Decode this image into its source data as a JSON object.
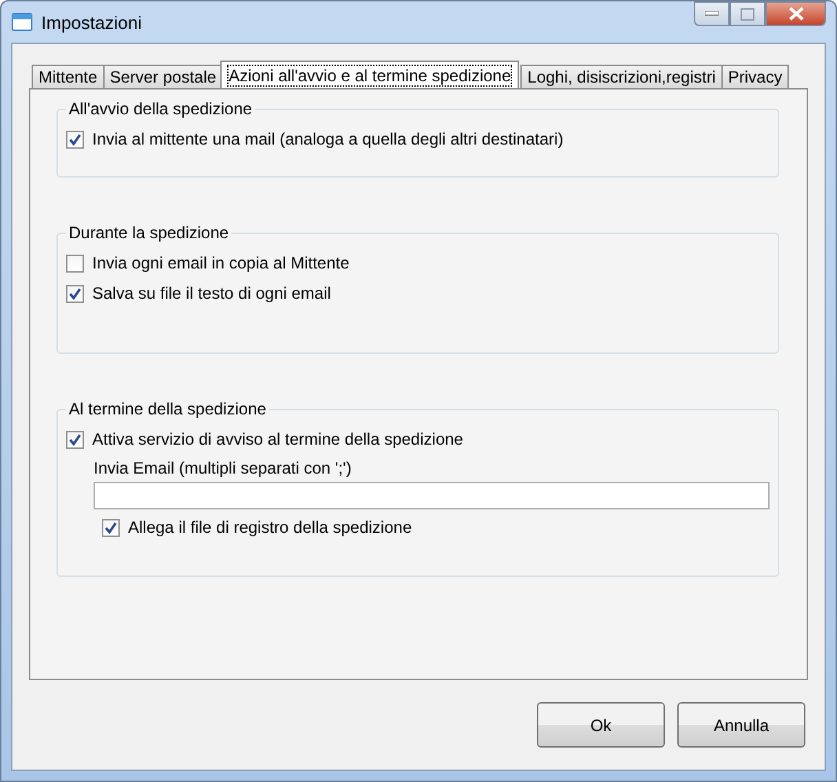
{
  "window": {
    "title": "Impostazioni"
  },
  "tabs": [
    {
      "label": "Mittente",
      "selected": false
    },
    {
      "label": "Server postale",
      "selected": false
    },
    {
      "label": "Azioni all'avvio e al termine spedizione",
      "selected": true
    },
    {
      "label": "Loghi, disiscrizioni,registri",
      "selected": false
    },
    {
      "label": "Privacy",
      "selected": false
    }
  ],
  "groups": [
    {
      "title": "All'avvio della spedizione",
      "items": [
        {
          "kind": "checkbox",
          "label": "Invia al mittente una mail (analoga a quella degli altri destinatari)",
          "checked": true
        }
      ]
    },
    {
      "title": "Durante la spedizione",
      "items": [
        {
          "kind": "checkbox",
          "label": "Invia ogni email in copia al Mittente",
          "checked": false
        },
        {
          "kind": "checkbox",
          "label": "Salva su file il testo di ogni email",
          "checked": true
        }
      ]
    },
    {
      "title": "Al termine della spedizione",
      "items": [
        {
          "kind": "checkbox",
          "label": "Attiva servizio di avviso al termine della spedizione",
          "checked": true,
          "children": [
            {
              "kind": "field",
              "label": "Invia Email (multipli separati con ';')"
            },
            {
              "kind": "checkbox",
              "label": "Allega il file di registro della spedizione",
              "checked": true
            }
          ]
        }
      ]
    }
  ],
  "buttons": [
    "Ok",
    "Annulla"
  ]
}
